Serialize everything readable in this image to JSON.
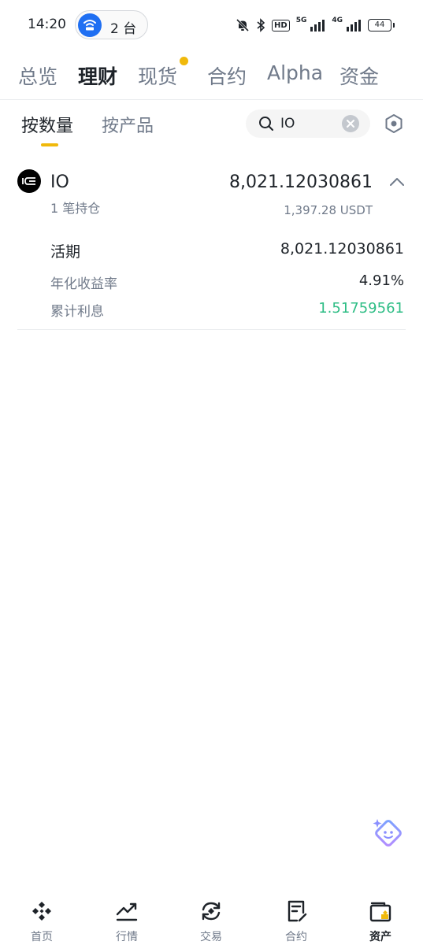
{
  "status_bar": {
    "time": "14:20",
    "hotspot_count": "2 台",
    "network_5g": "5G",
    "network_4g": "4G",
    "hd_badge": "HD",
    "battery": "44"
  },
  "top_tabs": [
    {
      "label": "总览",
      "active": false
    },
    {
      "label": "理财",
      "active": true
    },
    {
      "label": "现货",
      "active": false,
      "has_dot": true
    },
    {
      "label": "合约",
      "active": false
    },
    {
      "label": "Alpha",
      "active": false
    },
    {
      "label": "资金",
      "active": false
    }
  ],
  "sub_tabs": [
    {
      "label": "按数量",
      "active": true
    },
    {
      "label": "按产品",
      "active": false
    }
  ],
  "search": {
    "value": "IO"
  },
  "asset": {
    "name": "IO",
    "positions": "1 笔持仓",
    "amount": "8,021.12030861",
    "usdt_value": "1,397.28 USDT",
    "details": {
      "type_label": "活期",
      "type_value": "8,021.12030861",
      "apr_label": "年化收益率",
      "apr_value": "4.91%",
      "interest_label": "累计利息",
      "interest_value": "1.51759561"
    }
  },
  "bottom_nav": [
    {
      "label": "首页",
      "icon": "home-icon",
      "active": false
    },
    {
      "label": "行情",
      "icon": "markets-icon",
      "active": false
    },
    {
      "label": "交易",
      "icon": "trade-icon",
      "active": false
    },
    {
      "label": "合约",
      "icon": "futures-icon",
      "active": false
    },
    {
      "label": "资产",
      "icon": "wallet-icon",
      "active": true
    }
  ],
  "colors": {
    "accent": "#f0b90b",
    "positive": "#2ebd85",
    "text_primary": "#1e2329",
    "text_secondary": "#707a8a",
    "hotspot_blue": "#1f6ff2"
  }
}
